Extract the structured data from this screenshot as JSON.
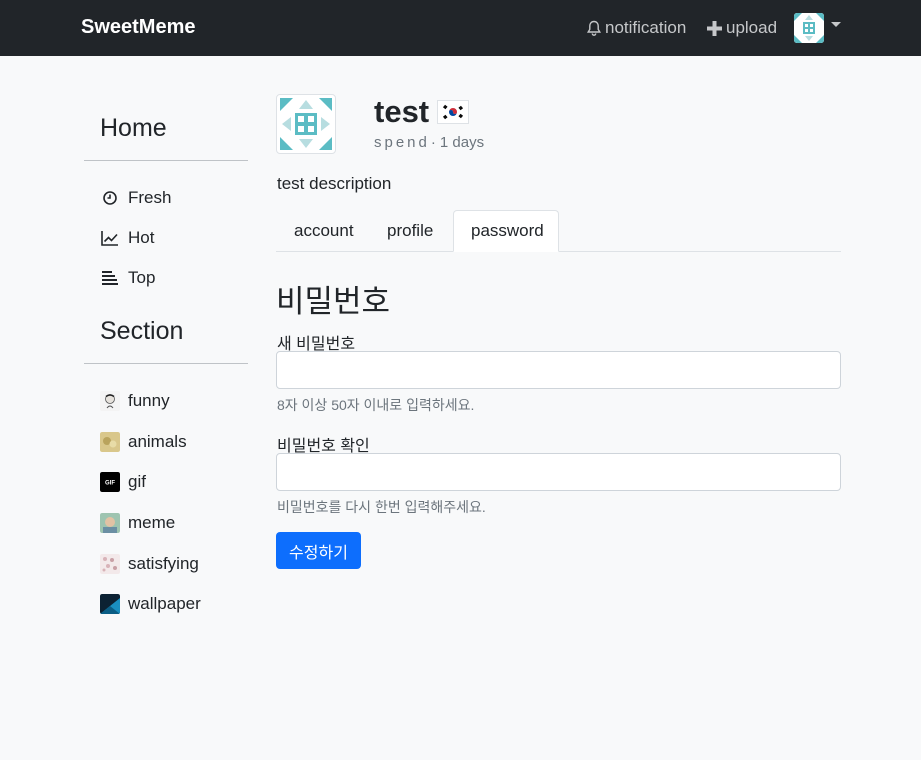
{
  "navbar": {
    "brand": "SweetMeme",
    "notification_label": "notification",
    "upload_label": "upload",
    "icons": {
      "notification": "bell-icon",
      "upload": "plus-icon",
      "menu": "caret-down-icon"
    }
  },
  "sidebar": {
    "home_heading": "Home",
    "home_items": [
      {
        "label": "Fresh",
        "icon": "clock-icon"
      },
      {
        "label": "Hot",
        "icon": "trend-chart-icon"
      },
      {
        "label": "Top",
        "icon": "bars-icon"
      }
    ],
    "section_heading": "Section",
    "section_items": [
      {
        "label": "funny"
      },
      {
        "label": "animals"
      },
      {
        "label": "gif",
        "thumb_text": "GIF"
      },
      {
        "label": "meme"
      },
      {
        "label": "satisfying"
      },
      {
        "label": "wallpaper"
      }
    ]
  },
  "profile": {
    "username": "test",
    "flag": "korea-flag-icon",
    "meta_spend": "spend",
    "meta_separator": "·",
    "meta_days": "1 days",
    "description": "test description"
  },
  "tabs": [
    {
      "label": "account",
      "active": false
    },
    {
      "label": "profile",
      "active": false
    },
    {
      "label": "password",
      "active": true
    }
  ],
  "form": {
    "title": "비밀번호",
    "new_password_label": "새 비밀번호",
    "new_password_value": "",
    "new_password_help": "8자 이상 50자 이내로 입력하세요.",
    "confirm_password_label": "비밀번호 확인",
    "confirm_password_value": "",
    "confirm_password_help": "비밀번호를 다시 한번 입력해주세요.",
    "submit_label": "수정하기"
  },
  "colors": {
    "navbar_bg": "#212529",
    "page_bg": "#f8f9fa",
    "primary_button": "#0d6efd",
    "avatar_teal": "#5bbcc4"
  }
}
